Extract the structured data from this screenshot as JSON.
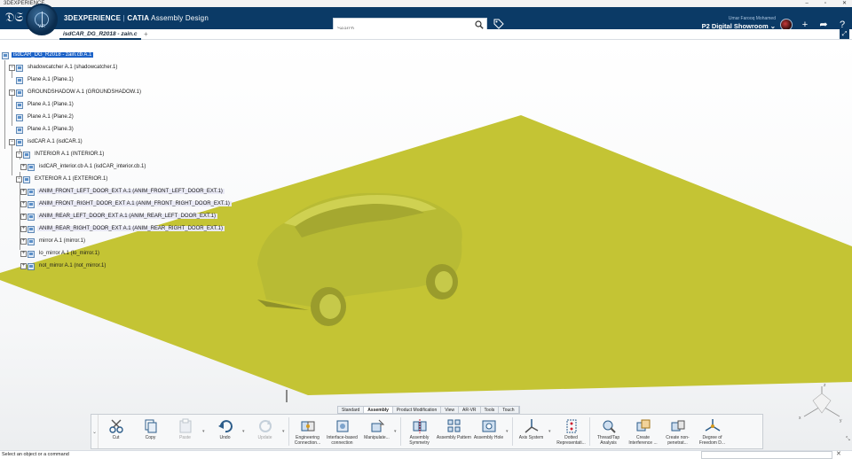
{
  "os": {
    "title": "3DEXPERIENCE",
    "controls": [
      "–",
      "▫",
      "✕"
    ]
  },
  "app": {
    "brand_bold": "3DEXPERIENCE",
    "brand_sep": " | ",
    "brand_product": "CATIA",
    "brand_app": " Assembly Design",
    "compass_label": "V.R"
  },
  "search": {
    "placeholder": "Search",
    "value": ""
  },
  "user": {
    "name": "Umar Farooq Mohamed",
    "space": "P2 Digital Showroom ⌄"
  },
  "tabs": {
    "doc_title": "isdCAR_DG_R2018 - zain.c",
    "add": "+"
  },
  "tree": [
    {
      "label": "isdCAR_DG_R2018 - zain.cb A.1",
      "toggle": "",
      "selected": true
    },
    {
      "label": "shadowcatcher A.1 (shadowcatcher.1)",
      "toggle": "−"
    },
    {
      "label": "Plane A.1 (Plane.1)",
      "toggle": ""
    },
    {
      "label": "GROUNDSHADOW A.1 (GROUNDSHADOW.1)",
      "toggle": "−"
    },
    {
      "label": "Plane A.1 (Plane.1)",
      "toggle": ""
    },
    {
      "label": "Plane A.1 (Plane.2)",
      "toggle": ""
    },
    {
      "label": "Plane A.1 (Plane.3)",
      "toggle": ""
    },
    {
      "label": "isdCAR A.1 (isdCAR.1)",
      "toggle": "−"
    },
    {
      "label": "INTERIOR A.1 (INTERIOR.1)",
      "toggle": "−"
    },
    {
      "label": "isdCAR_interior.cb A.1 (isdCAR_interior.cb.1)",
      "toggle": "+"
    },
    {
      "label": "EXTERIOR A.1 (EXTERIOR.1)",
      "toggle": "−"
    },
    {
      "label": "ANIM_FRONT_LEFT_DOOR_EXT A.1 (ANIM_FRONT_LEFT_DOOR_EXT.1)",
      "toggle": "+",
      "highlight": true
    },
    {
      "label": "ANIM_FRONT_RIGHT_DOOR_EXT A.1 (ANIM_FRONT_RIGHT_DOOR_EXT.1)",
      "toggle": "+",
      "highlight": true
    },
    {
      "label": "ANIM_REAR_LEFT_DOOR_EXT A.1 (ANIM_REAR_LEFT_DOOR_EXT.1)",
      "toggle": "+",
      "highlight": true
    },
    {
      "label": "ANIM_REAR_RIGHT_DOOR_EXT A.1 (ANIM_REAR_RIGHT_DOOR_EXT.1)",
      "toggle": "+",
      "highlight": true
    },
    {
      "label": "mirror A.1 (mirror.1)",
      "toggle": "+"
    },
    {
      "label": "lo_mirror A.1 (lo_mirror.1)",
      "toggle": "+"
    },
    {
      "label": "not_mirror A.1 (not_mirror.1)",
      "toggle": "+"
    }
  ],
  "section_tabs": [
    "Standard",
    "Assembly",
    "Product Modification",
    "View",
    "AR-VR",
    "Tools",
    "Touch"
  ],
  "active_section": "Assembly",
  "toolbar": [
    {
      "label": "Cut",
      "icon": "scissors-icon"
    },
    {
      "label": "Copy",
      "icon": "copy-icon"
    },
    {
      "label": "Paste",
      "icon": "paste-icon",
      "disabled": true
    },
    {
      "label": "Undo",
      "icon": "undo-icon"
    },
    {
      "label": "Update",
      "icon": "update-icon",
      "disabled": true
    },
    {
      "label": "Engineering Connection...",
      "icon": "engineering-connection-icon"
    },
    {
      "label": "Interface-based connection",
      "icon": "interface-connection-icon"
    },
    {
      "label": "Manipulate...",
      "icon": "manipulate-icon"
    },
    {
      "label": "Assembly Symmetry",
      "icon": "assembly-symmetry-icon"
    },
    {
      "label": "Assembly Pattern",
      "icon": "assembly-pattern-icon"
    },
    {
      "label": "Assembly Hole",
      "icon": "assembly-hole-icon"
    },
    {
      "label": "Axis System",
      "icon": "axis-system-icon"
    },
    {
      "label": "Dotted Representati...",
      "icon": "dotted-representation-icon"
    },
    {
      "label": "Thread/Tap Analysis",
      "icon": "thread-tap-icon"
    },
    {
      "label": "Create Interference ...",
      "icon": "create-interference-icon"
    },
    {
      "label": "Create non-penetrat...",
      "icon": "non-penetration-icon"
    },
    {
      "label": "Degree of Freedom D...",
      "icon": "degree-of-freedom-icon"
    }
  ],
  "status": {
    "message": "Select an object or a command"
  },
  "colors": {
    "ground": "#c4c434",
    "car": "#bcbf35",
    "brand": "#0b3a66",
    "selection": "#1d63c8"
  }
}
